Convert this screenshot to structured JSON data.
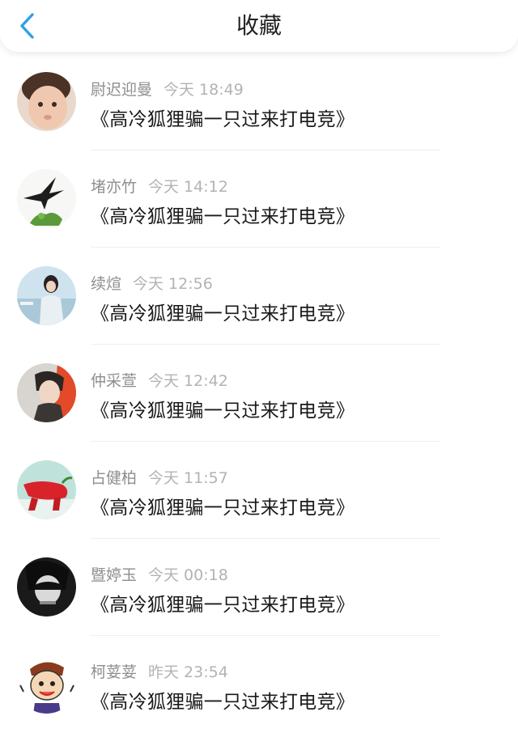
{
  "header": {
    "title": "收藏",
    "back_icon": "chevron-left-icon",
    "accent_color": "#2f9fe8"
  },
  "items": [
    {
      "name": "尉迟迎曼",
      "time": "今天 18:49",
      "message": "《高冷狐狸骗一只过来打电竞》",
      "avatar_icon": "baby-photo-avatar"
    },
    {
      "name": "堵亦竹",
      "time": "今天 14:12",
      "message": "《高冷狐狸骗一只过来打电竞》",
      "avatar_icon": "swallow-bird-avatar"
    },
    {
      "name": "续煊",
      "time": "今天 12:56",
      "message": "《高冷狐狸骗一只过来打电竞》",
      "avatar_icon": "girl-seaside-avatar"
    },
    {
      "name": "仲采萱",
      "time": "今天 12:42",
      "message": "《高冷狐狸骗一只过来打电竞》",
      "avatar_icon": "boy-portrait-avatar"
    },
    {
      "name": "占健柏",
      "time": "今天 11:57",
      "message": "《高冷狐狸骗一只过来打电竞》",
      "avatar_icon": "red-pepper-avatar"
    },
    {
      "name": "暨婷玉",
      "time": "今天 00:18",
      "message": "《高冷狐狸骗一只过来打电竞》",
      "avatar_icon": "dark-portrait-avatar"
    },
    {
      "name": "柯荽荽",
      "time": "昨天 23:54",
      "message": "《高冷狐狸骗一只过来打电竞》",
      "avatar_icon": "cartoon-face-avatar"
    }
  ]
}
